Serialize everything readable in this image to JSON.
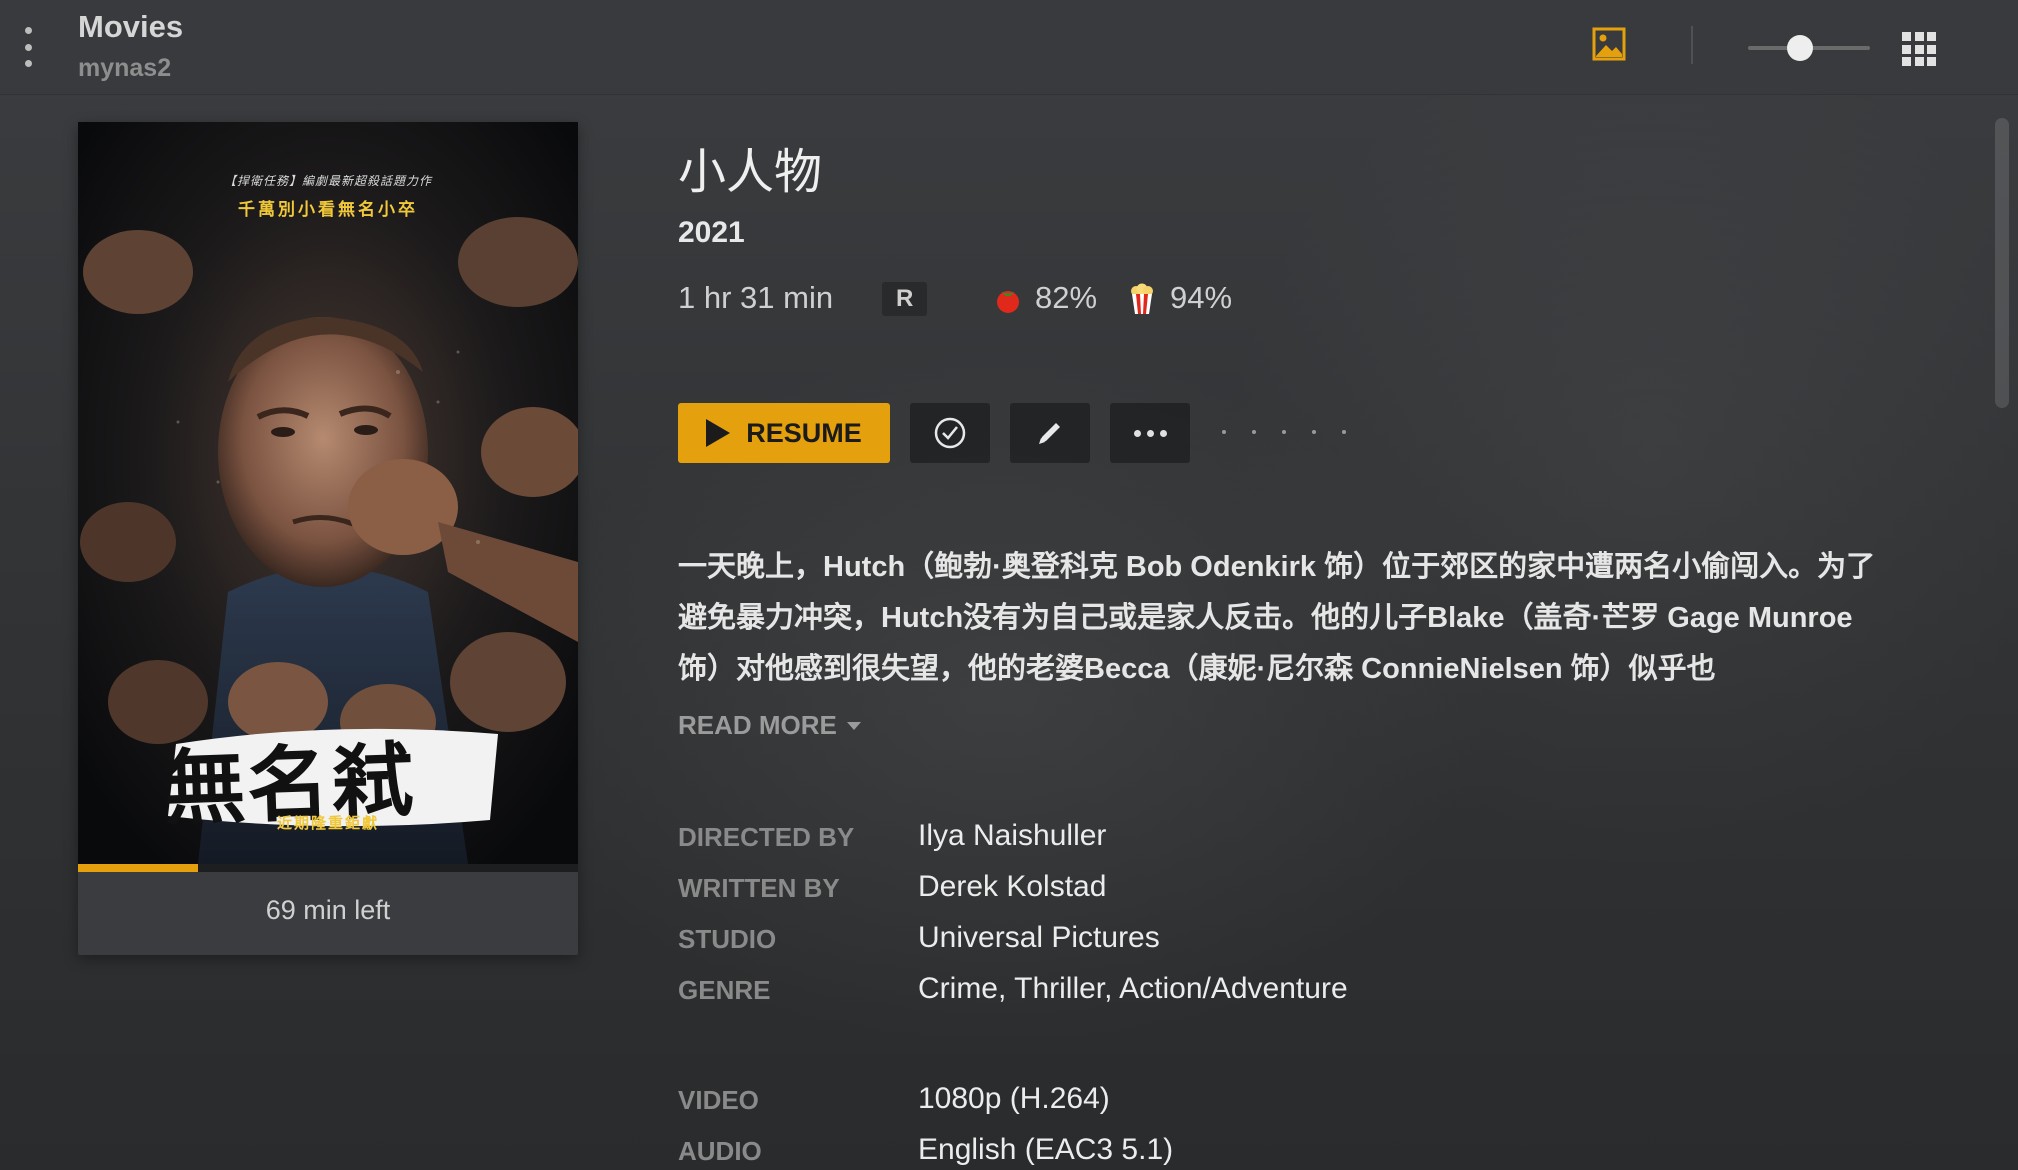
{
  "header": {
    "library_title": "Movies",
    "server_name": "mynas2",
    "zoom_level": 0.43
  },
  "poster": {
    "top_line": "【捍衛任務】編劇最新超殺話題力作",
    "tagline": "千萬別小看無名小卒",
    "title_art": "無名弒",
    "bottom_line": "近期隆重鉅獻",
    "progress_percent": 24,
    "time_left": "69 min left"
  },
  "movie": {
    "title": "小人物",
    "year": "2021",
    "duration": "1 hr 31 min",
    "content_rating": "R",
    "critic_score": "82%",
    "audience_score": "94%",
    "summary": "一天晚上，Hutch（鲍勃·奥登科克 Bob Odenkirk 饰）位于郊区的家中遭两名小偷闯入。为了避免暴力冲突，Hutch没有为自己或是家人反击。他的儿子Blake（盖奇·芒罗 Gage Munroe 饰）对他感到很失望，他的老婆Becca（康妮·尼尔森 ConnieNielsen 饰）似乎也",
    "read_more_label": "READ MORE"
  },
  "actions": {
    "resume_label": "RESUME"
  },
  "details": [
    {
      "label": "DIRECTED BY",
      "value": "Ilya Naishuller"
    },
    {
      "label": "WRITTEN BY",
      "value": "Derek Kolstad"
    },
    {
      "label": "STUDIO",
      "value": "Universal Pictures"
    },
    {
      "label": "GENRE",
      "value": "Crime, Thriller, Action/Adventure"
    },
    {
      "label": "VIDEO",
      "value": "1080p (H.264)"
    },
    {
      "label": "AUDIO",
      "value": "English (EAC3 5.1)"
    }
  ],
  "colors": {
    "accent": "#e5a00d",
    "background": "#333538",
    "label_gray": "#8a8a8a"
  },
  "icons": [
    "menu-dots-icon",
    "photo-icon",
    "grid-icon",
    "tomato-icon",
    "popcorn-icon",
    "play-icon",
    "checkmark-icon",
    "pencil-icon",
    "more-icon"
  ]
}
